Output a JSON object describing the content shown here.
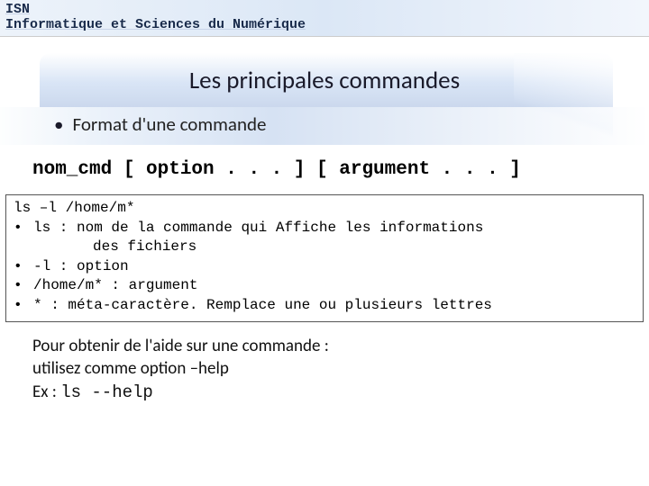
{
  "header": {
    "line1": "ISN",
    "line2": "Informatique et Sciences du Numérique"
  },
  "title": "Les principales commandes",
  "bullet": {
    "text": "Format d'une commande"
  },
  "syntax": "nom_cmd [ option . . . ] [ argument . . . ]",
  "example": {
    "cmd": "ls –l /home/m*",
    "items": [
      {
        "term": "ls",
        "desc": "nom de la commande qui Affiche les informations",
        "cont": "des fichiers"
      },
      {
        "term": "-l",
        "desc": "option"
      },
      {
        "term": "/home/m*",
        "desc": "argument"
      },
      {
        "term": "*",
        "desc": "méta-caractère. Remplace une ou plusieurs lettres"
      }
    ]
  },
  "note": {
    "line1": "Pour obtenir de l'aide sur une commande :",
    "line2": "utilisez comme option –help",
    "line3a": "Ex : ",
    "line3b": "ls --help"
  }
}
